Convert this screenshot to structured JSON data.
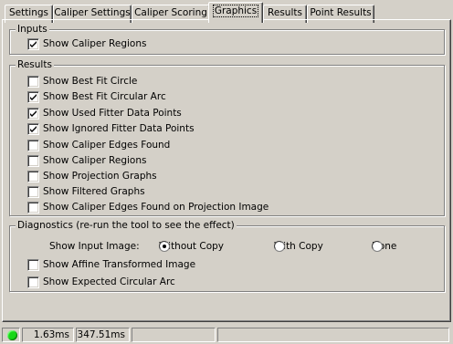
{
  "tabs": [
    {
      "label": "Settings",
      "active": false
    },
    {
      "label": "Caliper Settings",
      "active": false
    },
    {
      "label": "Caliper Scoring",
      "active": false
    },
    {
      "label": "Graphics",
      "active": true
    },
    {
      "label": "Results",
      "active": false
    },
    {
      "label": "Point Results",
      "active": false
    }
  ],
  "inputs": {
    "title": "Inputs",
    "items": [
      {
        "label": "Show Caliper Regions",
        "checked": true
      }
    ]
  },
  "results": {
    "title": "Results",
    "items": [
      {
        "label": "Show Best Fit Circle",
        "checked": false
      },
      {
        "label": "Show Best Fit Circular Arc",
        "checked": true
      },
      {
        "label": "Show Used Fitter Data Points",
        "checked": true
      },
      {
        "label": "Show Ignored Fitter Data Points",
        "checked": true
      },
      {
        "label": "Show Caliper Edges Found",
        "checked": false
      },
      {
        "label": "Show Caliper Regions",
        "checked": false
      },
      {
        "label": "Show Projection Graphs",
        "checked": false
      },
      {
        "label": "Show Filtered Graphs",
        "checked": false
      },
      {
        "label": "Show Caliper Edges Found on Projection Image",
        "checked": false
      }
    ]
  },
  "diagnostics": {
    "title": "Diagnostics (re-run the tool to see the effect)",
    "input_image_label": "Show Input Image:",
    "radio_options": [
      {
        "label": "Without Copy",
        "selected": true
      },
      {
        "label": "With Copy",
        "selected": false
      },
      {
        "label": "None",
        "selected": false
      }
    ],
    "items": [
      {
        "label": "Show Affine Transformed Image",
        "checked": false
      },
      {
        "label": "Show Expected Circular Arc",
        "checked": false
      }
    ]
  },
  "status": {
    "indicator_color": "#18d818",
    "time_1": "1.63ms",
    "time_2": "347.51ms"
  }
}
